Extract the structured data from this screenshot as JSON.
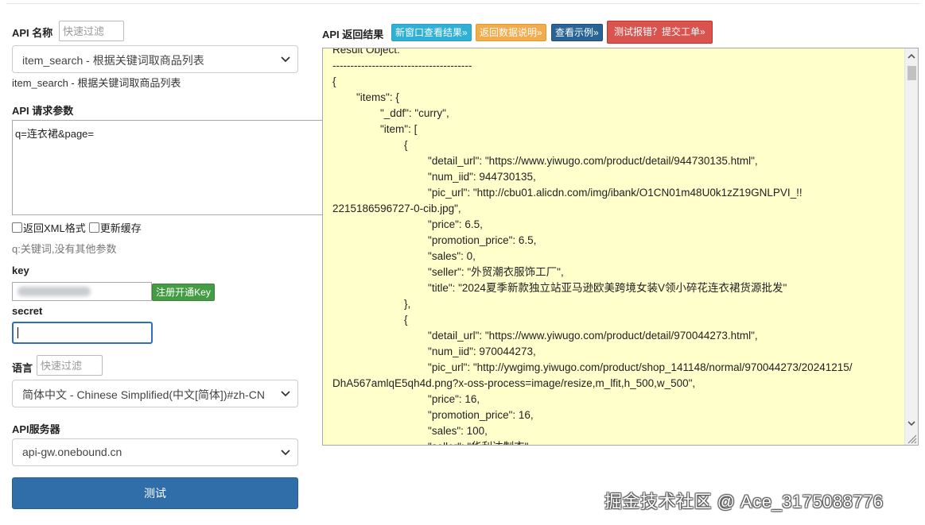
{
  "api_name": {
    "label": "API 名称",
    "filter_placeholder": "快速过滤"
  },
  "api_select": {
    "value": "item_search - 根据关键词取商品列表",
    "desc": "item_search - 根据关键词取商品列表"
  },
  "request_params": {
    "label": "API 请求参数",
    "value": "q=连衣裙&page="
  },
  "options": {
    "xml_label": "返回XML格式",
    "cache_label": "更新缓存",
    "hint": "q:关键词,没有其他参数"
  },
  "key": {
    "label": "key",
    "register_button": "注册开通Key"
  },
  "secret": {
    "label": "secret"
  },
  "language": {
    "label": "语言",
    "filter_placeholder": "快速过滤",
    "value": "简体中文 - Chinese Simplified(中文[简体])#zh-CN"
  },
  "server": {
    "label": "API服务器",
    "value": "api-gw.onebound.cn"
  },
  "test_button": "测试",
  "result": {
    "label": "API 返回结果",
    "buttons": {
      "new_window": "新窗口查看结果»",
      "data_desc": "返回数据说明»",
      "example": "查看示例»",
      "report": "测试报错？提交工单»"
    },
    "lines": [
      "Result Object:",
      "---------------------------------------",
      "{",
      "        \"items\": {",
      "                \"_ddf\": \"curry\",",
      "                \"item\": [",
      "                        {",
      "                                \"detail_url\": \"https://www.yiwugo.com/product/detail/944730135.html\",",
      "                                \"num_iid\": 944730135,",
      "                                \"pic_url\": \"http://cbu01.alicdn.com/img/ibank/O1CN01m48U0k1zZ19GNLPVI_!!",
      "2215186596727-0-cib.jpg\",",
      "                                \"price\": 6.5,",
      "                                \"promotion_price\": 6.5,",
      "                                \"sales\": 0,",
      "                                \"seller\": \"外贸潮衣服饰工厂\",",
      "                                \"title\": \"2024夏季新款独立站亚马逊欧美跨境女装V领小碎花连衣裙货源批发\"",
      "                        },",
      "                        {",
      "                                \"detail_url\": \"https://www.yiwugo.com/product/detail/970044273.html\",",
      "                                \"num_iid\": 970044273,",
      "                                \"pic_url\": \"http://ywgimg.yiwugo.com/product/shop_141148/normal/970044273/20241215/",
      "DhA567amlqE5qh4d.png?x-oss-process=image/resize,m_lfit,h_500,w_500\",",
      "                                \"price\": 16,",
      "                                \"promotion_price\": 16,",
      "                                \"sales\": 100,",
      "                                \"seller\": \"华利达制衣\","
    ]
  },
  "watermark": "掘金技术社区 @ Ace_3175088776",
  "colors": {
    "result_bg": "#ffffcc",
    "primary": "#2f6ea8",
    "success": "#449d44",
    "danger": "#d9534f",
    "warning": "#f0ad4e",
    "info": "#31b0d5"
  }
}
